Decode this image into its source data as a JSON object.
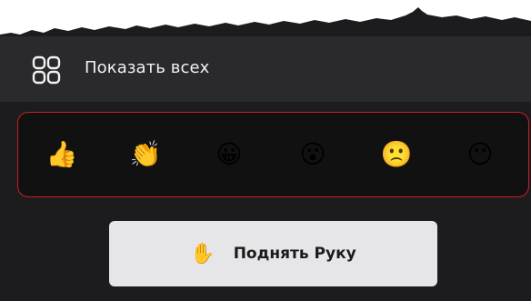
{
  "header": {
    "icon": "grid-icon",
    "label": "Показать всех"
  },
  "reactions": [
    {
      "name": "thumbs-up",
      "glyph": "👍"
    },
    {
      "name": "clapping-hands",
      "glyph": "👏"
    },
    {
      "name": "grinning-face",
      "glyph": "😀"
    },
    {
      "name": "surprised-face",
      "glyph": "😮"
    },
    {
      "name": "frowning-face",
      "glyph": "🙁"
    },
    {
      "name": "neutral-face",
      "glyph": "😶"
    }
  ],
  "raise_hand": {
    "icon": "raised-hand-icon",
    "glyph": "✋",
    "label": "Поднять Руку"
  },
  "colors": {
    "panel_bg": "#1c1c1e",
    "header_bg": "#2a2a2d",
    "highlight_border": "#c91f1f",
    "button_bg": "#e6e6e8"
  }
}
